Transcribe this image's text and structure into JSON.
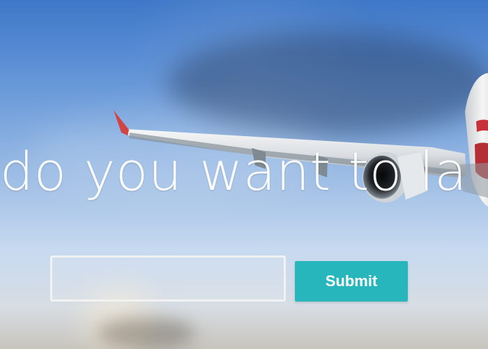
{
  "hero": {
    "headline": "e do you want to la"
  },
  "search": {
    "value": "",
    "placeholder": ""
  },
  "submit": {
    "label": "Submit"
  },
  "colors": {
    "button_teal": "#27b6bb",
    "text_white": "#ffffff",
    "sky_blue": "#5b8fd5"
  },
  "icons": {
    "background_image": "airplane-in-sky-image"
  }
}
